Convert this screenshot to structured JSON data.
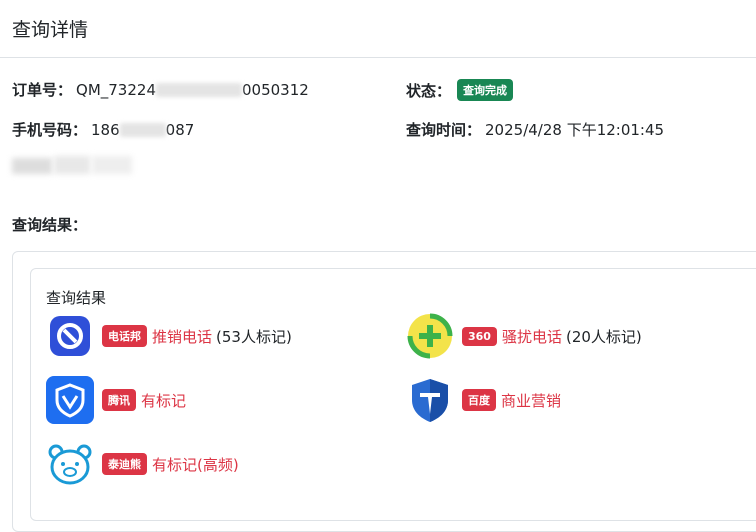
{
  "header": {
    "title": "查询详情"
  },
  "details": {
    "order_label": "订单号：",
    "order_prefix": "QM_73224",
    "order_suffix": "0050312",
    "status_label": "状态：",
    "status_value": "查询完成",
    "phone_label": "手机号码：",
    "phone_prefix": "186",
    "phone_suffix": "087",
    "time_label": "查询时间：",
    "time_value": "2025/4/28 下午12:01:45"
  },
  "results": {
    "section_title": "查询结果：",
    "card_title": "查询结果",
    "items": [
      {
        "icon": "dianhuabang-logo-icon",
        "source": "电话邦",
        "tag": "推销电话",
        "count": "(53人标记)"
      },
      {
        "icon": "360-logo-icon",
        "source": "360",
        "tag": "骚扰电话",
        "count": "(20人标记)"
      },
      {
        "icon": "tencent-shield-logo-icon",
        "source": "腾讯",
        "tag": "有标记",
        "count": ""
      },
      {
        "icon": "baidu-shield-logo-icon",
        "source": "百度",
        "tag": "商业营销",
        "count": ""
      },
      {
        "icon": "teddy-bear-logo-icon",
        "source": "泰迪熊",
        "tag": "有标记(高频)",
        "count": ""
      }
    ]
  },
  "colors": {
    "success": "#198754",
    "danger": "#dc3545",
    "border": "#dee2e6"
  }
}
